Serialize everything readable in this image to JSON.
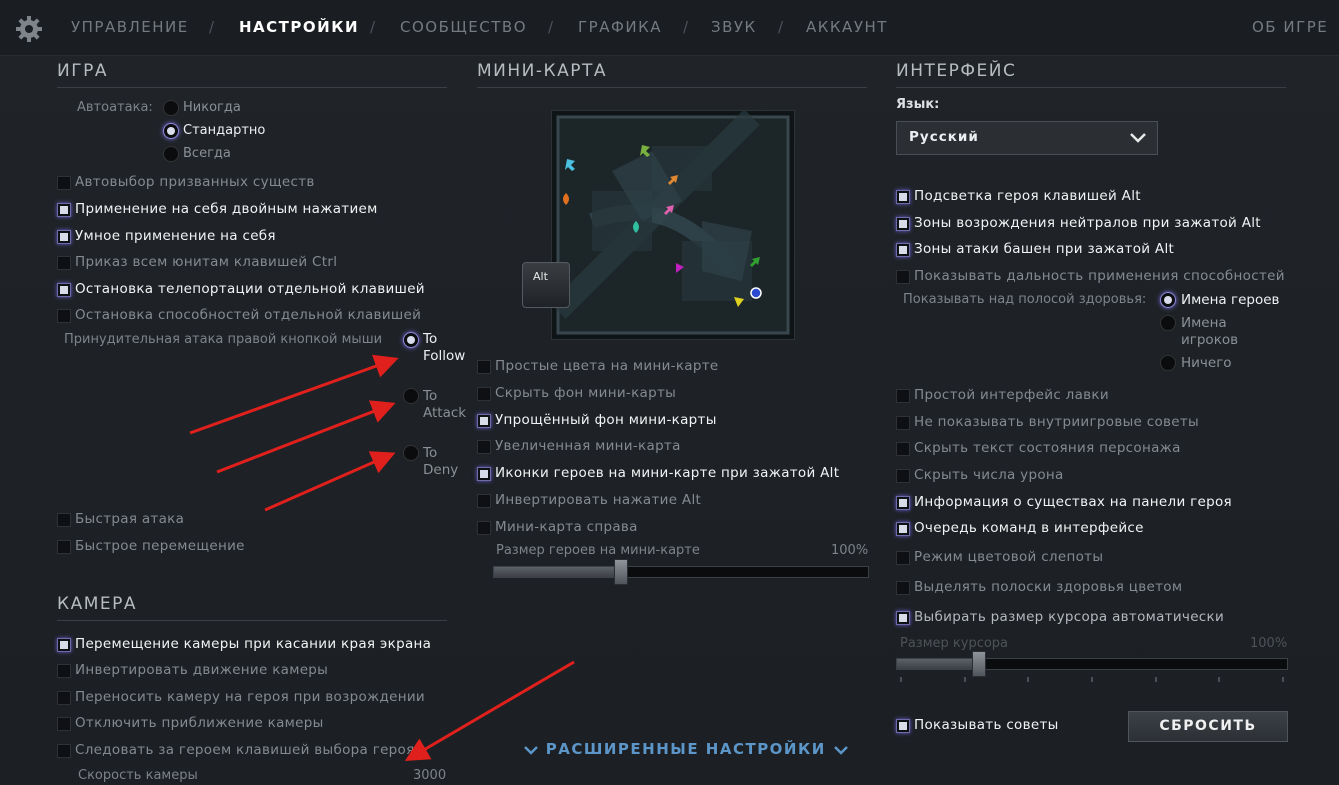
{
  "nav": {
    "tabs": [
      "УПРАВЛЕНИЕ",
      "НАСТРОЙКИ",
      "СООБЩЕСТВО",
      "ГРАФИКА",
      "ЗВУК",
      "АККАУНТ"
    ],
    "separator": "/",
    "about": "ОБ ИГРЕ",
    "active": "НАСТРОЙКИ"
  },
  "game": {
    "title": "ИГРА",
    "autoattack_label": "Автоатака:",
    "autoattack_options": [
      "Никогда",
      "Стандартно",
      "Всегда"
    ],
    "autoattack_selected": "Стандартно",
    "checkboxes": [
      {
        "label": "Автовыбор призванных существ",
        "checked": false
      },
      {
        "label": "Применение на себя двойным нажатием",
        "checked": true
      },
      {
        "label": "Умное применение на себя",
        "checked": true
      },
      {
        "label": "Приказ всем юнитам клавишей Ctrl",
        "checked": false
      },
      {
        "label": "Остановка телепортации отдельной клавишей",
        "checked": true
      },
      {
        "label": "Остановка способностей отдельной клавишей",
        "checked": false
      }
    ],
    "force_attack_label": "Принудительная атака правой кнопкой мыши",
    "force_attack_options": [
      "To Follow",
      "To Attack",
      "To Deny"
    ],
    "force_attack_lines": [
      [
        "To",
        "Follow"
      ],
      [
        "To",
        "Attack"
      ],
      [
        "To",
        "Deny"
      ]
    ],
    "force_attack_selected": "To Follow",
    "checkboxes2": [
      {
        "label": "Быстрая атака",
        "checked": false
      },
      {
        "label": "Быстрое перемещение",
        "checked": false
      }
    ]
  },
  "camera": {
    "title": "КАМЕРА",
    "checkboxes": [
      {
        "label": "Перемещение камеры при касании края экрана",
        "checked": true
      },
      {
        "label": "Инвертировать движение камеры",
        "checked": false
      },
      {
        "label": "Переносить камеру на героя при возрождении",
        "checked": false
      },
      {
        "label": "Отключить приближение камеры",
        "checked": false
      },
      {
        "label": "Следовать за героем клавишей выбора героя",
        "checked": false
      }
    ],
    "speed_label": "Скорость камеры",
    "speed_value": "3000"
  },
  "minimap": {
    "title": "МИНИ-КАРТА",
    "alt_key": "Alt",
    "checkboxes": [
      {
        "label": "Простые цвета на мини-карте",
        "checked": false
      },
      {
        "label": "Скрыть фон мини-карты",
        "checked": false
      },
      {
        "label": "Упрощённый фон мини-карты",
        "checked": true
      },
      {
        "label": "Увеличенная мини-карта",
        "checked": false
      },
      {
        "label": "Иконки героев на мини-карте при зажатой Alt",
        "checked": true
      },
      {
        "label": "Инвертировать нажатие Alt",
        "checked": false
      },
      {
        "label": "Мини-карта справа",
        "checked": false
      }
    ],
    "hero_size_label": "Размер героев на мини-карте",
    "hero_size_value": "100%",
    "hero_size_level": 0.34
  },
  "interface": {
    "title": "ИНТЕРФЕЙС",
    "language_label": "Язык:",
    "language_value": "Русский",
    "checkboxes": [
      {
        "label": "Подсветка героя клавишей Alt",
        "checked": true
      },
      {
        "label": "Зоны возрождения нейтралов при зажатой Alt",
        "checked": true
      },
      {
        "label": "Зоны атаки башен при зажатой Alt",
        "checked": true
      },
      {
        "label": "Показывать дальность применения способностей",
        "checked": false
      }
    ],
    "health_label": "Показывать над полосой здоровья:",
    "health_options": [
      "Имена героев",
      "Имена игроков",
      "Ничего"
    ],
    "health_lines": [
      [
        "Имена героев"
      ],
      [
        "Имена",
        "игроков"
      ],
      [
        "Ничего"
      ]
    ],
    "health_selected": "Имена героев",
    "checkboxes2": [
      {
        "label": "Простой интерфейс лавки",
        "checked": false
      },
      {
        "label": "Не показывать внутриигровые советы",
        "checked": false
      },
      {
        "label": "Скрыть текст состояния персонажа",
        "checked": false
      },
      {
        "label": "Скрыть числа урона",
        "checked": false
      },
      {
        "label": "Информация о существах на панели героя",
        "checked": true
      },
      {
        "label": "Очередь команд в интерфейсе",
        "checked": true
      },
      {
        "label": "Режим цветовой слепоты",
        "checked": false
      },
      {
        "label": "Выделять полоски здоровья цветом",
        "checked": false
      },
      {
        "label": "Выбирать размер курсора автоматически",
        "checked": true
      }
    ],
    "cursor_size_label": "Размер курсора",
    "cursor_size_value": "100%",
    "cursor_size_level": 0.21,
    "show_tips_label": "Показывать советы",
    "show_tips_checked": true,
    "reset_button": "СБРОСИТЬ"
  },
  "advanced_settings": "РАСШИРЕННЫЕ НАСТРОЙКИ",
  "colors": {
    "accent": "#5c96c8",
    "arrow": "#e0201c",
    "active_text": "#ffffff"
  }
}
